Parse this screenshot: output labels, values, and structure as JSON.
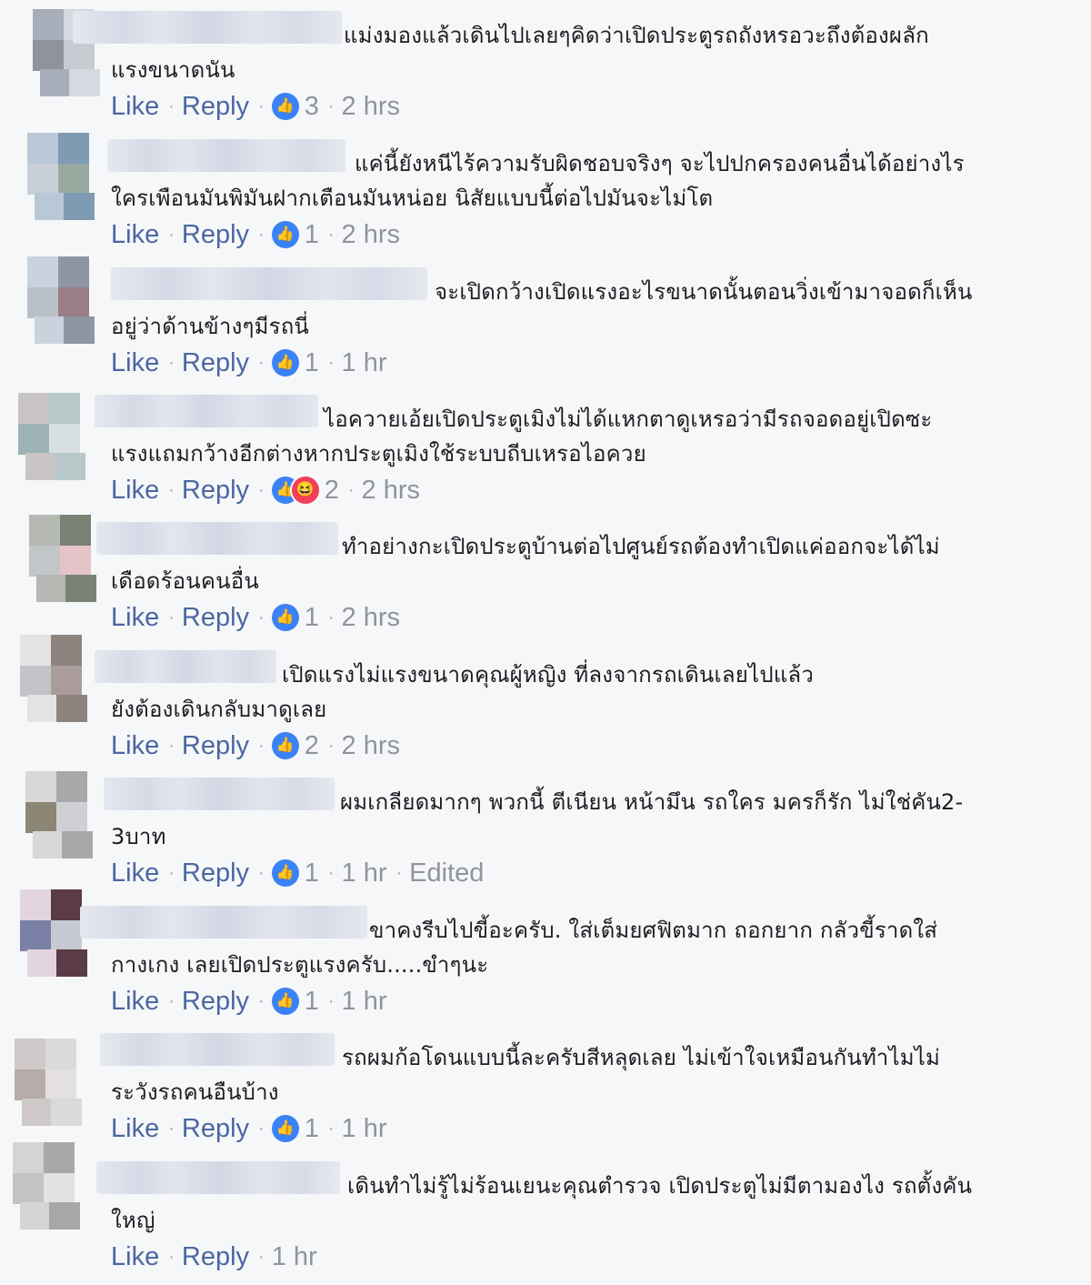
{
  "labels": {
    "like": "Like",
    "reply": "Reply",
    "sep": "·"
  },
  "comments": [
    {
      "line1": "แม่งมองแล้วเดินไปเลยๆคิดว่าเปิดประตูรถถังหรอวะถึงต้องผลัก",
      "line2": "แรงขนาดนัน",
      "reactions": "like",
      "count": "3",
      "time": "2 hrs",
      "edited": ""
    },
    {
      "line1": "แค่นี้ยังหนีไร้ความรับผิดชอบจริงๆ จะไปปกครองคนอื่นได้อย่างไร",
      "line2": "ใครเพือนมันพิมันฝากเตือนมันหน่อย นิสัยแบบนี้ต่อไปมันจะไม่โต",
      "reactions": "like",
      "count": "1",
      "time": "2 hrs",
      "edited": ""
    },
    {
      "line1": "จะเปิดกว้างเปิดแรงอะไรขนาดนั้นตอนวิ่งเข้ามาจอดก็เห็น",
      "line2": "อยู่ว่าด้านข้างๆมีรถนี่",
      "reactions": "like",
      "count": "1",
      "time": "1 hr",
      "edited": ""
    },
    {
      "line1": "ไอควายเอ้ยเปิดประตูเมิงไม่ได้แหกตาดูเหรอว่ามีรถจอดอยู่เปิดซะ",
      "line2": "แรงแถมกว้างอีกต่างหากประตูเมิงใช้ระบบถีบเหรอไอควย",
      "reactions": "like-haha",
      "count": "2",
      "time": "2 hrs",
      "edited": ""
    },
    {
      "line1": "ทำอย่างกะเปิดประตูบ้านต่อไปศูนย์รถต้องทำเปิดแค่ออกจะได้ไม่",
      "line2": "เดือดร้อนคนอื่น",
      "reactions": "like",
      "count": "1",
      "time": "2 hrs",
      "edited": ""
    },
    {
      "line1": "เปิดแรงไม่แรงขนาดคุณผู้หญิง ที่ลงจากรถเดินเลยไปแล้ว",
      "line2": "ยังต้องเดินกลับมาดูเลย",
      "reactions": "like",
      "count": "2",
      "time": "2 hrs",
      "edited": ""
    },
    {
      "line1": "ผมเกลียดมากๆ พวกนี้ ตีเนียน หน้ามึน รถใคร มครก็รัก ไม่ใช่คัน2-",
      "line2": "3บาท",
      "reactions": "like",
      "count": "1",
      "time": "1 hr",
      "edited": "Edited"
    },
    {
      "line1": "ขาคงรีบไปขี้อะครับ. ใส่เต็มยศฟิตมาก ถอกยาก กลัวขี้ราดใส่",
      "line2": "กางเกง เลยเปิดประตูแรงครับ.....ขำๆนะ",
      "reactions": "like",
      "count": "1",
      "time": "1 hr",
      "edited": ""
    },
    {
      "line1": "รถผมก้อโดนแบบนี้ละครับสีหลุดเลย ไม่เข้าใจเหมือนกันทำไมไม่",
      "line2": "ระวังรถคนอืนบ้าง",
      "reactions": "like",
      "count": "1",
      "time": "1 hr",
      "edited": ""
    },
    {
      "line1": "เดินทำไม่รู้ไม่ร้อนเยนะคุณตำรวจ เปิดประตูไม่มีตามองไง รถตั้งคัน",
      "line2": "ใหญ่",
      "reactions": "",
      "count": "",
      "time": "1 hr",
      "edited": ""
    }
  ],
  "colors": {
    "link": "#4b67a1",
    "meta": "#90949c",
    "like_reaction": "#3b82f6",
    "haha_reaction": "#f33e58"
  }
}
